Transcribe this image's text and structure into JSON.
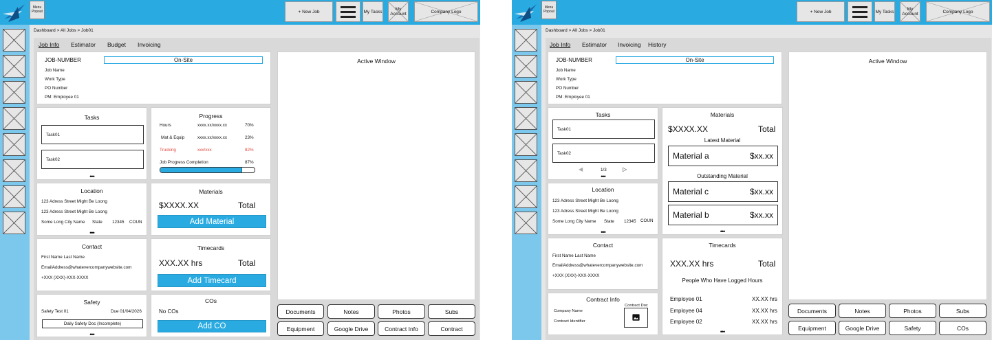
{
  "left": {
    "topbar": {
      "menu_popout": "Menu Popout",
      "new_job": "+ New Job",
      "my_tasks": "My Tasks",
      "my_account": "My Account",
      "company_logo": "Company Logo"
    },
    "breadcrumb": "Dashboard > All Jobs > Job01",
    "tabs": [
      "Job Info",
      "Estimator",
      "Budget",
      "Invoicing"
    ],
    "job": {
      "number": "JOB-NUMBER",
      "status": "On-Site",
      "name": "Job Name",
      "work_type": "Work Type",
      "po": "PO Number",
      "pm": "PM: Employee 01"
    },
    "tasks": {
      "title": "Tasks",
      "items": [
        "Task01",
        "Task02"
      ],
      "more": "•••"
    },
    "progress": {
      "title": "Progress",
      "rows": [
        {
          "label": "Hours",
          "value": "xxxx.xx/xxxx.xx",
          "pct": "70%",
          "alert": false
        },
        {
          "label": "Mat & Equip",
          "value": "xxxx.xx/xxxx.xx",
          "pct": "23%",
          "alert": false
        },
        {
          "label": "Trucking",
          "value": "xxx/xxx",
          "pct": "82%",
          "alert": true
        }
      ],
      "completion_label": "Job Progress Completion",
      "completion_pct": "87%",
      "completion_value": 0.87
    },
    "location": {
      "title": "Location",
      "line1": "123 Adress Street Might Be Loong",
      "line2": "123 Adress Street Might Be Loong",
      "city": "Some Long City Name",
      "state": "State",
      "zip": "12345",
      "country": "COUN",
      "more": "•••"
    },
    "materials": {
      "title": "Materials",
      "amount": "$XXXX.XX",
      "total": "Total",
      "add": "Add Material"
    },
    "contact": {
      "title": "Contact",
      "name": "First Name Last Name",
      "email": "EmailAddress@whatevercompanywebsite.com",
      "phone": "+XXX (XXX)-XXX-XXXX"
    },
    "timecards": {
      "title": "Timecards",
      "hours": "XXX.XX hrs",
      "total": "Total",
      "add": "Add Timecard"
    },
    "safety": {
      "title": "Safety",
      "item": "Safety Test 01",
      "due": "Due 01/04/2026",
      "doc": "Daily Safety Doc (Incomplete)",
      "more": "•••"
    },
    "cos": {
      "title": "COs",
      "none": "No COs",
      "add": "Add CO"
    },
    "active_window": "Active Window",
    "buttons": [
      "Documents",
      "Notes",
      "Photos",
      "Subs",
      "Equipment",
      "Google Drive",
      "Contract Info",
      "Contract"
    ]
  },
  "right": {
    "topbar": {
      "menu_popout": "Menu Popout",
      "new_job": "+ New Job",
      "my_tasks": "My Tasks",
      "my_account": "My Account",
      "company_logo": "Company Logo"
    },
    "breadcrumb": "Dashboard > All Jobs > Job01",
    "tabs": [
      "Job Info",
      "Estimator",
      "Invoicing",
      "History"
    ],
    "job": {
      "number": "JOB-NUMBER",
      "status": "On-Site",
      "name": "Job Name",
      "work_type": "Work Type",
      "po": "PO Number",
      "pm": "PM: Employee 01"
    },
    "tasks": {
      "title": "Tasks",
      "items": [
        "Task01",
        "Task02"
      ],
      "pager": "1/3",
      "more": "•••"
    },
    "materials": {
      "title": "Materials",
      "amount": "$XXXX.XX",
      "total": "Total",
      "latest_title": "Latest Material",
      "latest": [
        {
          "name": "Material a",
          "price": "$xx.xx"
        }
      ],
      "outstanding_title": "Outstanding Material",
      "outstanding": [
        {
          "name": "Material c",
          "price": "$xx.xx"
        },
        {
          "name": "Material b",
          "price": "$xx.xx"
        }
      ],
      "more": "•••"
    },
    "location": {
      "title": "Location",
      "line1": "123 Adress Street Might Be Loong",
      "line2": "123 Adress Street Might Be Loong",
      "city": "Some Long City Name",
      "state": "State",
      "zip": "12345",
      "country": "COUN",
      "more": "•••"
    },
    "contact": {
      "title": "Contact",
      "name": "First Name Last Name",
      "email": "EmailAddress@whatevercompanywebsite.com",
      "phone": "+XXX (XXX)-XXX-XXXX"
    },
    "timecards": {
      "title": "Timecards",
      "hours": "XXX.XX hrs",
      "total": "Total",
      "people_title": "People Who Have Logged Hours",
      "people": [
        {
          "name": "Employee 01",
          "hrs": "XX.XX hrs"
        },
        {
          "name": "Employee 04",
          "hrs": "XX.XX hrs"
        },
        {
          "name": "Employee 02",
          "hrs": "XX.XX hrs"
        }
      ],
      "more": "•••"
    },
    "contract_info": {
      "title": "Contract Info",
      "company": "Company Name",
      "identifier": "Contract Identifier",
      "doc": "Contract Doc"
    },
    "active_window": "Active Window",
    "buttons": [
      "Documents",
      "Notes",
      "Photos",
      "Subs",
      "Equipment",
      "Google Drive",
      "Safety",
      "COs"
    ]
  }
}
